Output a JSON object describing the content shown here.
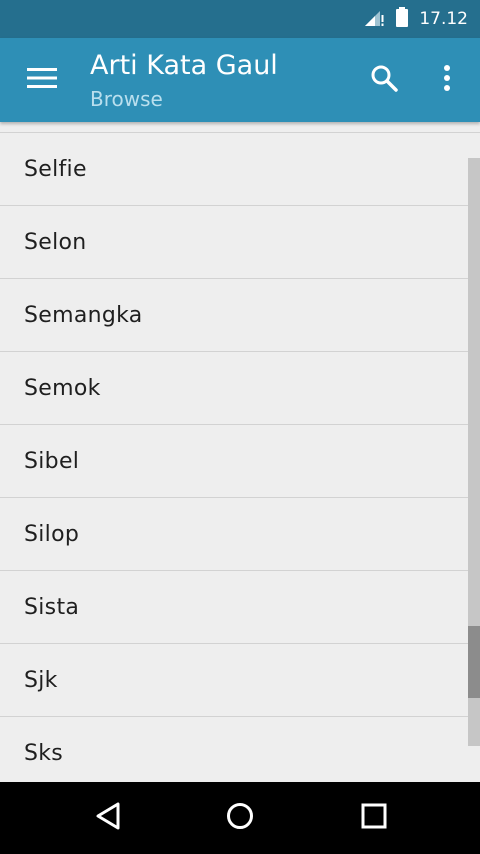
{
  "status_bar": {
    "time": "17.12",
    "icons": [
      "signal-no-data-icon",
      "battery-icon"
    ]
  },
  "app_bar": {
    "title": "Arti Kata Gaul",
    "subtitle": "Browse",
    "icons": [
      "menu-icon",
      "search-icon",
      "overflow-menu-icon"
    ]
  },
  "list": {
    "items": [
      {
        "label": "Selfie"
      },
      {
        "label": "Selon"
      },
      {
        "label": "Semangka"
      },
      {
        "label": "Semok"
      },
      {
        "label": "Sibel"
      },
      {
        "label": "Silop"
      },
      {
        "label": "Sista"
      },
      {
        "label": "Sjk"
      },
      {
        "label": "Sks"
      }
    ]
  },
  "nav_bar": {
    "icons": [
      "back-icon",
      "home-icon",
      "recents-icon"
    ]
  },
  "colors": {
    "status_bar": "#256f8e",
    "app_bar": "#2e8fb6",
    "subtitle": "#b9dfee",
    "background": "#eeeeee",
    "divider": "#d2d2d2"
  }
}
